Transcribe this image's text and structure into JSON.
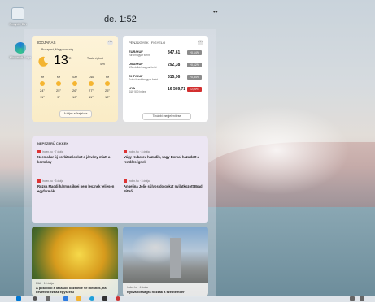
{
  "desktop": {
    "recycle_bin": "Recycle Bin",
    "edge": "Microsoft Edge",
    "clock": "de. 1:52"
  },
  "weather": {
    "title": "IDŐJÁRÁS",
    "location": "Budapest, Magyarország",
    "temp": "13",
    "unit": "°C",
    "condition": "Tiszta égbolt",
    "precip": "4 %",
    "forecast": [
      {
        "day": "Hé",
        "hi": "24°",
        "lo": "11°"
      },
      {
        "day": "Ke",
        "hi": "25°",
        "lo": "9°"
      },
      {
        "day": "Sze",
        "hi": "26°",
        "lo": "10°"
      },
      {
        "day": "Csü",
        "hi": "27°",
        "lo": "11°"
      },
      {
        "day": "Pé",
        "hi": "25°",
        "lo": "12°"
      }
    ],
    "button": "A teljes előrejelzés"
  },
  "stocks": {
    "title": "PÉNZÜGYEK | FIGYELŐ",
    "rows": [
      {
        "sym": "EUR/HUF",
        "name": "euró/magyar forint",
        "val": "347,61",
        "chg": "+0,14%",
        "color": "#8c8c8c"
      },
      {
        "sym": "USD/HUF",
        "name": "USA dollár/magyar forint",
        "val": "292,38",
        "chg": "+0,12%",
        "color": "#8c8c8c"
      },
      {
        "sym": "CHF/HUF",
        "name": "Svájci frank/magyar forint",
        "val": "315,96",
        "chg": "+0,34%",
        "color": "#8c8c8c"
      },
      {
        "sym": "NYA",
        "name": "S&P 500 Index",
        "val": "16 509,72",
        "chg": "-0,59%",
        "color": "#d32f2f"
      }
    ],
    "button": "További megjelenítése"
  },
  "news": {
    "title": "NÉPSZERŰ CIKKEK",
    "items": [
      {
        "src": "Index.hu · 7 órája",
        "head": "Neen akar új korlátozásokat a járvány miatt a kormány"
      },
      {
        "src": "Index.hu · 8 órája",
        "head": "Vágy Kubatov hazudik, vagy Borkai hazudott a rendőrségnek"
      },
      {
        "src": "Index.hu · 3 órája",
        "head": "Rúzsa Magdi hármas ikrei nem lesznek teljesen egyformák"
      },
      {
        "src": "Index.hu · 3 órája",
        "head": "Angelina Jolie súlyos dolgokat nyilatkozott Brad Pittről"
      }
    ]
  },
  "images": {
    "left": {
      "src": "Blikk · 10 órája",
      "head": "A pokolból a lakásod közelébe se mennek, ha bevetted ezt az egyszerű"
    },
    "right": {
      "src": "Index.hu · 4 órája",
      "head": "Nyilvánosságra hozzák a szeptember"
    }
  },
  "colors": {
    "accent": "#0078d4",
    "negative": "#d32f2f"
  }
}
